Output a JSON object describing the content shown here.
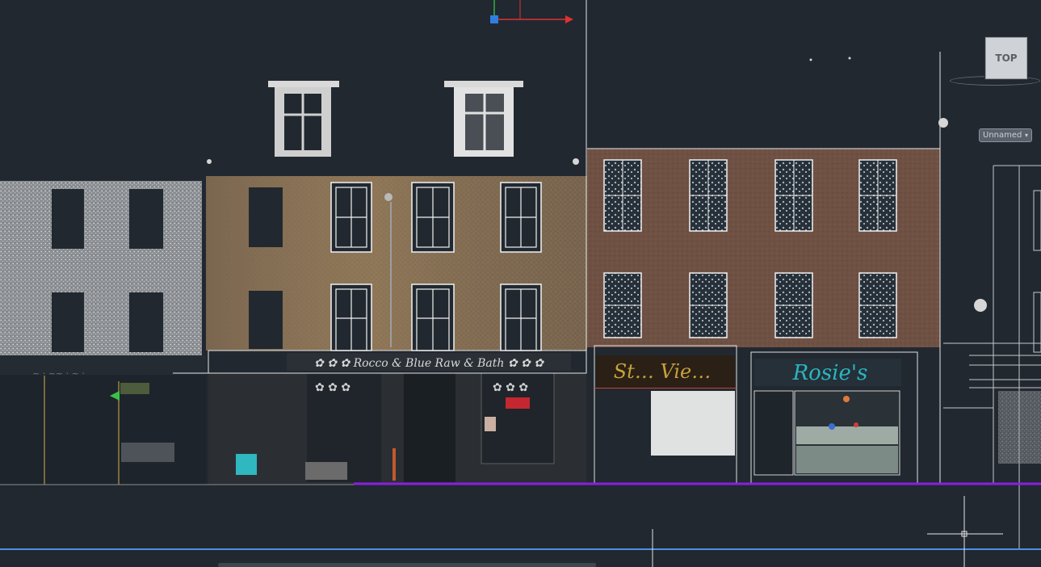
{
  "viewcube": {
    "face_label": "TOP"
  },
  "ucs_menu": {
    "label": "Unnamed",
    "caret": "▾"
  },
  "signs": {
    "shop1": "✿ ✿ ✿ Rocco & Blue Raw & Bath ✿ ✿ ✿",
    "shop2": "Rosie's",
    "shop3": "St… Vie…"
  },
  "colors": {
    "background": "#212830",
    "ground_line": "#8a1fe0",
    "guide_line": "#4f8fe8",
    "axis_x": "#e03030",
    "axis_y": "#30b040",
    "ucs_origin": "#2f7fe0"
  },
  "icons": [
    "ucs-axis-icon",
    "viewcube-icon",
    "compass-icon",
    "crosshair-cursor-icon"
  ]
}
